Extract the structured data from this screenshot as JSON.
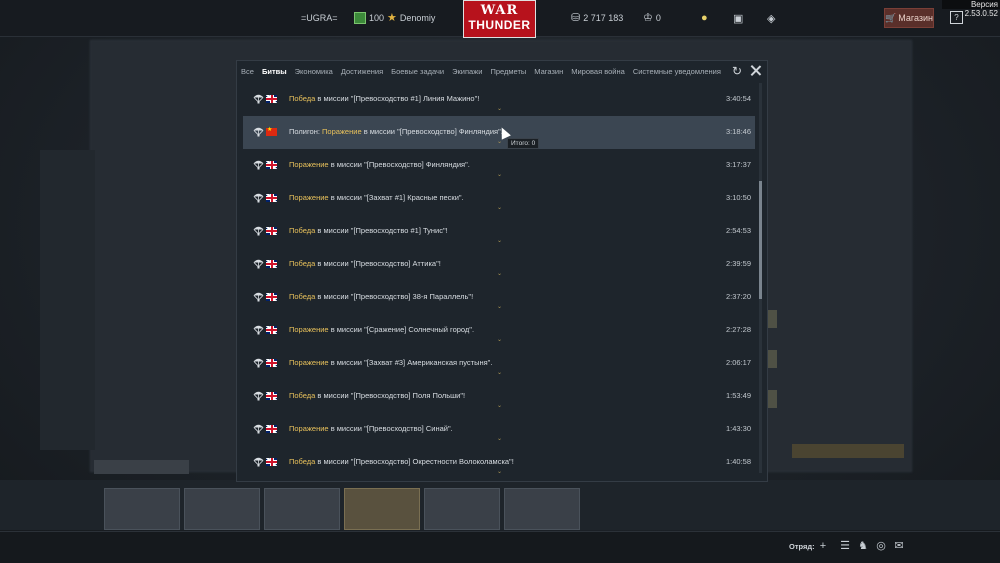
{
  "app": {
    "version": "Версия 2.53.0.52"
  },
  "topbar": {
    "squadron_tag": "=UGRA=",
    "gold_amount": "100",
    "nickname": "Denomiy",
    "logo_line1": "WAR",
    "logo_line2": "THUNDER",
    "silver_lions": "2 717 183",
    "research_points": "0",
    "shop_label": "Магазин",
    "help_label": "?"
  },
  "modal": {
    "tabs": [
      {
        "label": "Все"
      },
      {
        "label": "Битвы"
      },
      {
        "label": "Экономика"
      },
      {
        "label": "Достижения"
      },
      {
        "label": "Боевые задачи"
      },
      {
        "label": "Экипажи"
      },
      {
        "label": "Предметы"
      },
      {
        "label": "Магазин"
      },
      {
        "label": "Мировая война"
      },
      {
        "label": "Системные уведомления"
      }
    ],
    "active_tab": "Битвы",
    "tooltip": "Итого: 0",
    "rows": [
      {
        "prefix": "",
        "result": "Победа",
        "text": " в миссии \"[Превосходство #1] Линия Мажино\"!",
        "time": "3:40:54",
        "flag": "uk"
      },
      {
        "prefix": "Полигон: ",
        "result": "Поражение",
        "text": " в миссии \"[Превосходство] Финляндия\".",
        "time": "3:18:46",
        "flag": "cn"
      },
      {
        "prefix": "",
        "result": "Поражение",
        "text": " в миссии \"[Превосходство] Финляндия\".",
        "time": "3:17:37",
        "flag": "uk"
      },
      {
        "prefix": "",
        "result": "Поражение",
        "text": " в миссии \"[Захват #1] Красные пески\".",
        "time": "3:10:50",
        "flag": "uk"
      },
      {
        "prefix": "",
        "result": "Победа",
        "text": " в миссии \"[Превосходство #1] Тунис\"!",
        "time": "2:54:53",
        "flag": "uk"
      },
      {
        "prefix": "",
        "result": "Победа",
        "text": " в миссии \"[Превосходство] Аттика\"!",
        "time": "2:39:59",
        "flag": "uk"
      },
      {
        "prefix": "",
        "result": "Победа",
        "text": " в миссии \"[Превосходство] 38-я Параллель\"!",
        "time": "2:37:20",
        "flag": "uk"
      },
      {
        "prefix": "",
        "result": "Поражение",
        "text": " в миссии \"[Сражение] Солнечный город\".",
        "time": "2:27:28",
        "flag": "uk"
      },
      {
        "prefix": "",
        "result": "Поражение",
        "text": " в миссии \"[Захват #3] Американская пустыня\".",
        "time": "2:06:17",
        "flag": "uk"
      },
      {
        "prefix": "",
        "result": "Победа",
        "text": " в миссии \"[Превосходство] Поля Польши\"!",
        "time": "1:53:49",
        "flag": "uk"
      },
      {
        "prefix": "",
        "result": "Поражение",
        "text": " в миссии \"[Превосходство] Синай\".",
        "time": "1:43:30",
        "flag": "uk"
      },
      {
        "prefix": "",
        "result": "Победа",
        "text": " в миссии \"[Превосходство] Окрестности Волоколамска\"!",
        "time": "1:40:58",
        "flag": "uk"
      }
    ]
  },
  "bottombar": {
    "squad_label": "Отряд:"
  },
  "colors": {
    "result": "#e8c15b",
    "highlight_row": "#3b4652",
    "logo_red": "#b7121c"
  },
  "icons": [
    "parachute-icon",
    "uk-flag-icon",
    "china-flag-icon",
    "reload-icon",
    "close-icon",
    "gold-icon",
    "silver-icon",
    "research-icon",
    "lightbulb-icon",
    "cart-icon",
    "help-icon",
    "plus-icon",
    "list-icon",
    "chat-icon",
    "mail-icon"
  ]
}
